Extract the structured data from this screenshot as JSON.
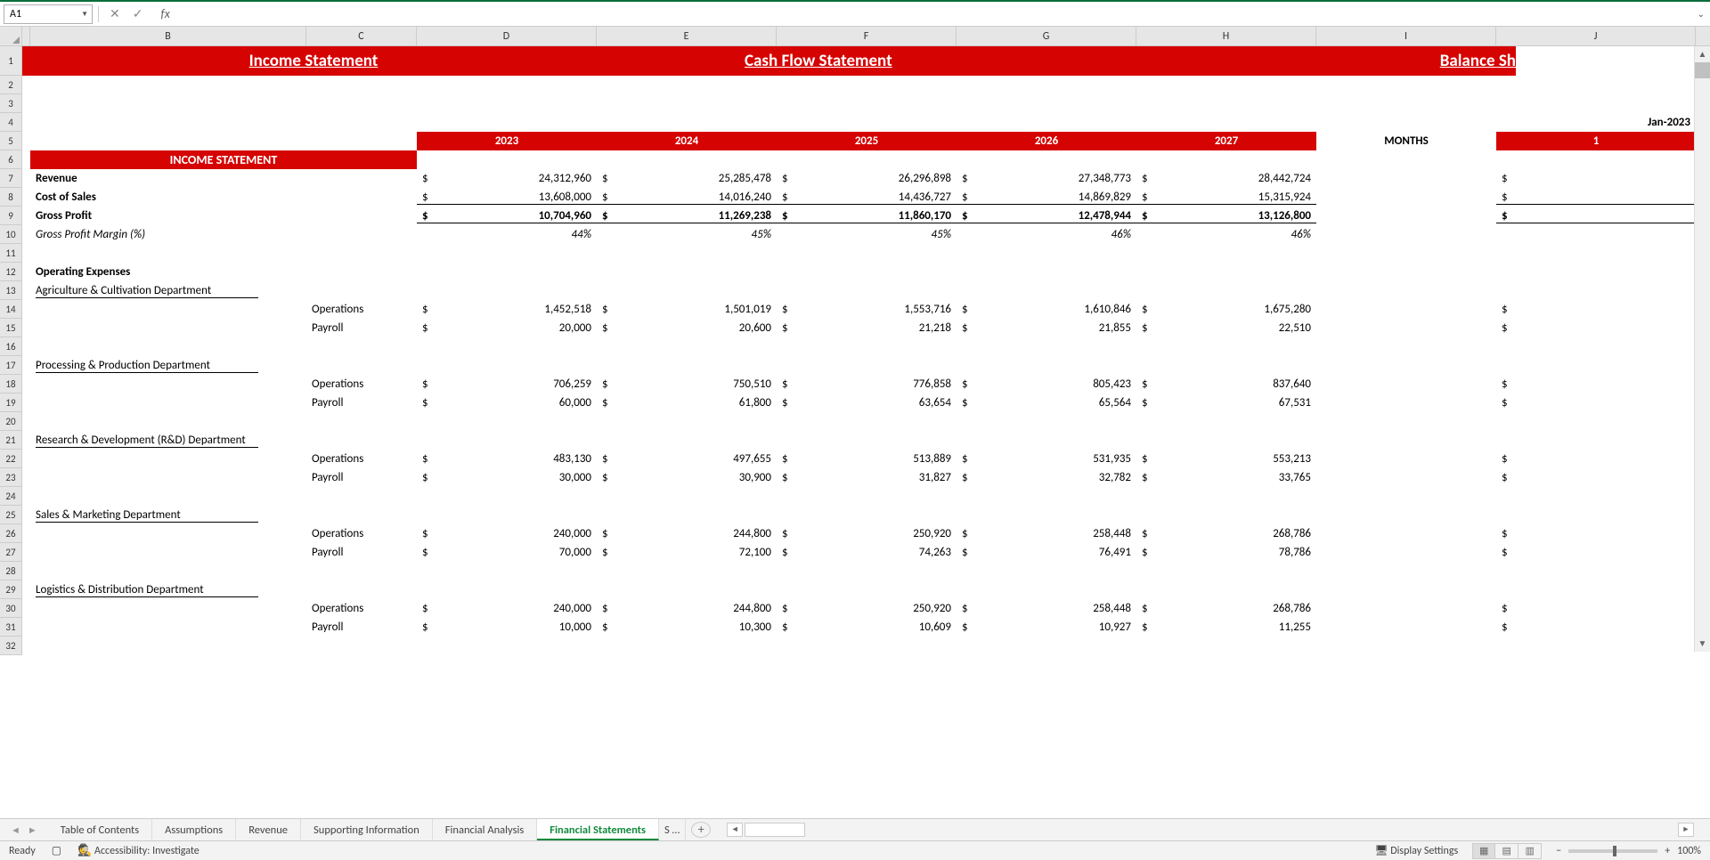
{
  "namebox": "A1",
  "fx_label": "fx",
  "banner": {
    "income": "Income Statement",
    "cashflow": "Cash Flow Statement",
    "balance": "Balance Sh"
  },
  "month_cell": "Jan-2023",
  "year_hdr": {
    "y2023": "2023",
    "y2024": "2024",
    "y2025": "2025",
    "y2026": "2026",
    "y2027": "2027",
    "months": "MONTHS",
    "j1": "1"
  },
  "section_label": "INCOME STATEMENT",
  "rows": {
    "revenue": {
      "label": "Revenue",
      "v": [
        "24,312,960",
        "25,285,478",
        "26,296,898",
        "27,348,773",
        "28,442,724"
      ]
    },
    "cos": {
      "label": "Cost of Sales",
      "v": [
        "13,608,000",
        "14,016,240",
        "14,436,727",
        "14,869,829",
        "15,315,924"
      ]
    },
    "gp": {
      "label": "Gross Profit",
      "v": [
        "10,704,960",
        "11,269,238",
        "11,860,170",
        "12,478,944",
        "13,126,800"
      ]
    },
    "gpm": {
      "label": "Gross Profit Margin (%)",
      "v": [
        "44%",
        "45%",
        "45%",
        "46%",
        "46%"
      ]
    },
    "opex": {
      "label": "Operating Expenses"
    },
    "dept1": {
      "label": "Agriculture & Cultivation Department"
    },
    "d1op": {
      "label": "Operations",
      "v": [
        "1,452,518",
        "1,501,019",
        "1,553,716",
        "1,610,846",
        "1,675,280"
      ]
    },
    "d1pr": {
      "label": "Payroll",
      "v": [
        "20,000",
        "20,600",
        "21,218",
        "21,855",
        "22,510"
      ]
    },
    "dept2": {
      "label": "Processing & Production Department"
    },
    "d2op": {
      "label": "Operations",
      "v": [
        "706,259",
        "750,510",
        "776,858",
        "805,423",
        "837,640"
      ]
    },
    "d2pr": {
      "label": "Payroll",
      "v": [
        "60,000",
        "61,800",
        "63,654",
        "65,564",
        "67,531"
      ]
    },
    "dept3": {
      "label": "Research & Development (R&D) Department"
    },
    "d3op": {
      "label": "Operations",
      "v": [
        "483,130",
        "497,655",
        "513,889",
        "531,935",
        "553,213"
      ]
    },
    "d3pr": {
      "label": "Payroll",
      "v": [
        "30,000",
        "30,900",
        "31,827",
        "32,782",
        "33,765"
      ]
    },
    "dept4": {
      "label": "Sales & Marketing Department"
    },
    "d4op": {
      "label": "Operations",
      "v": [
        "240,000",
        "244,800",
        "250,920",
        "258,448",
        "268,786"
      ]
    },
    "d4pr": {
      "label": "Payroll",
      "v": [
        "70,000",
        "72,100",
        "74,263",
        "76,491",
        "78,786"
      ]
    },
    "dept5": {
      "label": "Logistics & Distribution Department"
    },
    "d5op": {
      "label": "Operations",
      "v": [
        "240,000",
        "244,800",
        "250,920",
        "258,448",
        "268,786"
      ]
    },
    "d5pr": {
      "label": "Payroll",
      "v": [
        "10,000",
        "10,300",
        "10,609",
        "10,927",
        "11,255"
      ]
    }
  },
  "dollar": "$",
  "tabs": [
    "Table of Contents",
    "Assumptions",
    "Revenue",
    "Supporting Information",
    "Financial Analysis",
    "Financial Statements",
    "S …"
  ],
  "active_tab_index": 5,
  "status": {
    "ready": "Ready",
    "acc": "Accessibility: Investigate",
    "display": "Display Settings",
    "zoom": "100%"
  },
  "col_letters": [
    "B",
    "C",
    "D",
    "E",
    "F",
    "G",
    "H",
    "I",
    "J"
  ],
  "chart_data": {
    "type": "table",
    "title": "Income Statement",
    "columns": [
      "2023",
      "2024",
      "2025",
      "2026",
      "2027"
    ],
    "series": [
      {
        "name": "Revenue",
        "values": [
          24312960,
          25285478,
          26296898,
          27348773,
          28442724
        ]
      },
      {
        "name": "Cost of Sales",
        "values": [
          13608000,
          14016240,
          14436727,
          14869829,
          15315924
        ]
      },
      {
        "name": "Gross Profit",
        "values": [
          10704960,
          11269238,
          11860170,
          12478944,
          13126800
        ]
      },
      {
        "name": "Gross Profit Margin (%)",
        "values": [
          44,
          45,
          45,
          46,
          46
        ]
      },
      {
        "name": "Agriculture & Cultivation – Operations",
        "values": [
          1452518,
          1501019,
          1553716,
          1610846,
          1675280
        ]
      },
      {
        "name": "Agriculture & Cultivation – Payroll",
        "values": [
          20000,
          20600,
          21218,
          21855,
          22510
        ]
      },
      {
        "name": "Processing & Production – Operations",
        "values": [
          706259,
          750510,
          776858,
          805423,
          837640
        ]
      },
      {
        "name": "Processing & Production – Payroll",
        "values": [
          60000,
          61800,
          63654,
          65564,
          67531
        ]
      },
      {
        "name": "R&D – Operations",
        "values": [
          483130,
          497655,
          513889,
          531935,
          553213
        ]
      },
      {
        "name": "R&D – Payroll",
        "values": [
          30000,
          30900,
          31827,
          32782,
          33765
        ]
      },
      {
        "name": "Sales & Marketing – Operations",
        "values": [
          240000,
          244800,
          250920,
          258448,
          268786
        ]
      },
      {
        "name": "Sales & Marketing – Payroll",
        "values": [
          70000,
          72100,
          74263,
          76491,
          78786
        ]
      },
      {
        "name": "Logistics & Distribution – Operations",
        "values": [
          240000,
          244800,
          250920,
          258448,
          268786
        ]
      },
      {
        "name": "Logistics & Distribution – Payroll",
        "values": [
          10000,
          10300,
          10609,
          10927,
          11255
        ]
      }
    ]
  }
}
